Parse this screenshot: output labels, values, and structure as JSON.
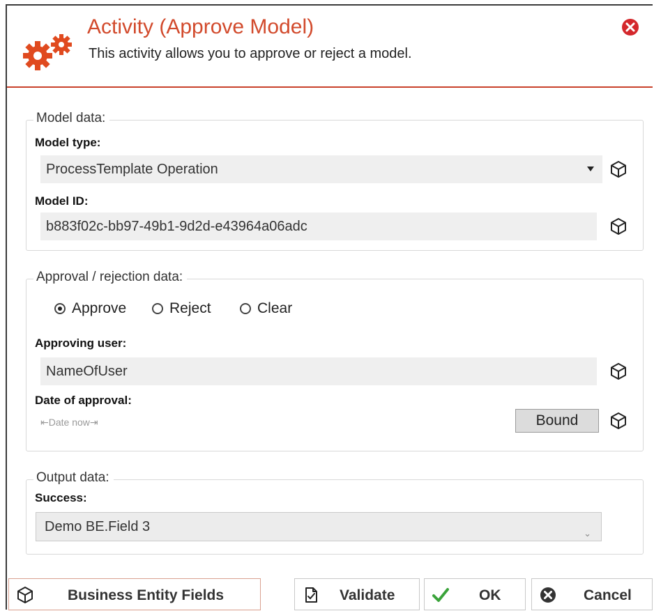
{
  "header": {
    "title": "Activity (Approve Model)",
    "subtitle": "This activity allows you to approve or reject a model."
  },
  "model_data": {
    "legend": "Model data:",
    "model_type_label": "Model type:",
    "model_type_value": "ProcessTemplate Operation",
    "model_id_label": "Model ID:",
    "model_id_value": "b883f02c-bb97-49b1-9d2d-e43964a06adc"
  },
  "approval": {
    "legend": "Approval / rejection data:",
    "options": [
      "Approve",
      "Reject",
      "Clear"
    ],
    "selected": "Approve",
    "approving_user_label": "Approving user:",
    "approving_user_value": "NameOfUser",
    "date_label": "Date of approval:",
    "date_value": "Date now",
    "bound_label": "Bound"
  },
  "output": {
    "legend": "Output data:",
    "success_label": "Success:",
    "success_value": "Demo BE.Field 3"
  },
  "buttons": {
    "business_entity_fields": "Business Entity Fields",
    "validate": "Validate",
    "ok": "OK",
    "cancel": "Cancel"
  },
  "colors": {
    "accent": "#d24a2c",
    "close": "#d4282c",
    "ok_check": "#3aa33a"
  }
}
